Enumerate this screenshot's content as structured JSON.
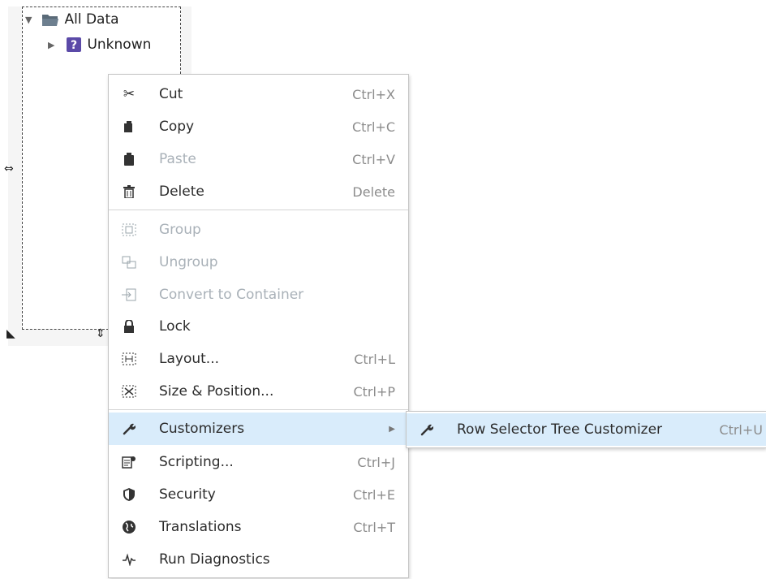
{
  "tree": {
    "root_label": "All Data",
    "child_label": "Unknown"
  },
  "context_menu": {
    "items": [
      {
        "label": "Cut",
        "shortcut": "Ctrl+X",
        "icon": "scissors-icon",
        "enabled": true
      },
      {
        "label": "Copy",
        "shortcut": "Ctrl+C",
        "icon": "copy-icon",
        "enabled": true
      },
      {
        "label": "Paste",
        "shortcut": "Ctrl+V",
        "icon": "clipboard-icon",
        "enabled": true
      },
      {
        "label": "Delete",
        "shortcut": "Delete",
        "icon": "trash-icon",
        "enabled": true
      },
      {
        "label": "Group",
        "shortcut": "",
        "icon": "group-icon",
        "enabled": false
      },
      {
        "label": "Ungroup",
        "shortcut": "",
        "icon": "ungroup-icon",
        "enabled": false
      },
      {
        "label": "Convert to Container",
        "shortcut": "",
        "icon": "container-icon",
        "enabled": false
      },
      {
        "label": "Lock",
        "shortcut": "",
        "icon": "lock-icon",
        "enabled": true
      },
      {
        "label": "Layout...",
        "shortcut": "Ctrl+L",
        "icon": "layout-icon",
        "enabled": true
      },
      {
        "label": "Size & Position...",
        "shortcut": "Ctrl+P",
        "icon": "size-position-icon",
        "enabled": true
      },
      {
        "label": "Customizers",
        "shortcut": "",
        "icon": "wrench-icon",
        "enabled": true,
        "has_submenu": true
      },
      {
        "label": "Scripting...",
        "shortcut": "Ctrl+J",
        "icon": "script-icon",
        "enabled": true
      },
      {
        "label": "Security",
        "shortcut": "Ctrl+E",
        "icon": "shield-icon",
        "enabled": true
      },
      {
        "label": "Translations",
        "shortcut": "Ctrl+T",
        "icon": "globe-icon",
        "enabled": true
      },
      {
        "label": "Run Diagnostics",
        "shortcut": "",
        "icon": "pulse-icon",
        "enabled": true
      }
    ]
  },
  "submenu": {
    "label": "Row Selector Tree Customizer",
    "shortcut": "Ctrl+U",
    "icon": "wrench-icon"
  },
  "colors": {
    "highlight": "#d9ecfb",
    "disabled_text": "#a9b1b8",
    "shortcut_text": "#8c8c8c"
  }
}
